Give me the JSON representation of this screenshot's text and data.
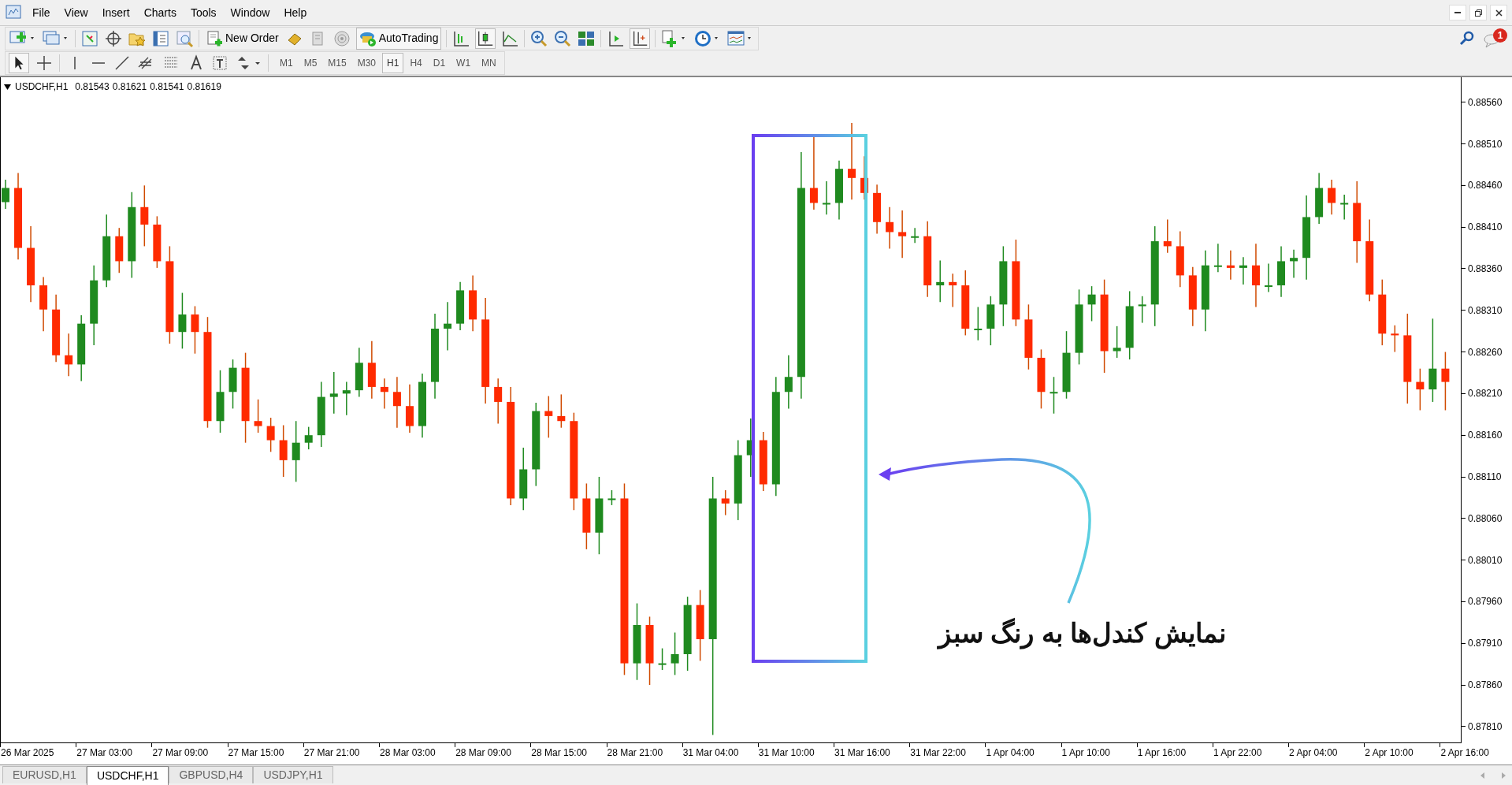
{
  "menu": [
    "File",
    "View",
    "Insert",
    "Charts",
    "Tools",
    "Window",
    "Help"
  ],
  "toolbar": {
    "new_order": "New Order",
    "auto_trading": "AutoTrading"
  },
  "timeframes": [
    {
      "label": "M1",
      "selected": false
    },
    {
      "label": "M5",
      "selected": false
    },
    {
      "label": "M15",
      "selected": false
    },
    {
      "label": "M30",
      "selected": false
    },
    {
      "label": "H1",
      "selected": true
    },
    {
      "label": "H4",
      "selected": false
    },
    {
      "label": "D1",
      "selected": false
    },
    {
      "label": "W1",
      "selected": false
    },
    {
      "label": "MN",
      "selected": false
    }
  ],
  "notification_count": "1",
  "chart": {
    "symbol": "USDCHF,H1",
    "ohlc": [
      "0.81543",
      "0.81621",
      "0.81541",
      "0.81619"
    ],
    "annotation": "نمایش کندل‌ها به رنگ سبز",
    "chart_data": {
      "type": "candlestick",
      "categories": [
        null,
        null,
        "26 Mar 2025",
        null,
        null,
        null,
        null,
        null,
        "27 Mar 03:00",
        null,
        null,
        null,
        null,
        null,
        "27 Mar 09:00",
        null,
        null,
        null,
        null,
        null,
        "27 Mar 15:00",
        null,
        null,
        null,
        null,
        null,
        "27 Mar 21:00",
        null,
        null,
        null,
        null,
        null,
        "28 Mar 03:00",
        null,
        null,
        null,
        null,
        null,
        "28 Mar 09:00",
        null,
        null,
        null,
        null,
        null,
        "28 Mar 15:00",
        null,
        null,
        null,
        null,
        null,
        "28 Mar 21:00",
        null,
        null,
        null,
        null,
        null,
        "31 Mar 04:00",
        null,
        null,
        null,
        null,
        null,
        "31 Mar 10:00",
        null,
        null,
        null,
        null,
        null,
        "31 Mar 16:00",
        null,
        null,
        null,
        null,
        null,
        "31 Mar 22:00",
        null,
        null,
        null,
        null,
        null,
        "1 Apr 04:00",
        null,
        null,
        null,
        null,
        null,
        "1 Apr 10:00",
        null,
        null,
        null,
        null,
        null,
        "1 Apr 16:00",
        null,
        null,
        null,
        null,
        null,
        "1 Apr 22:00",
        null,
        null,
        null,
        null,
        null,
        "2 Apr 04:00",
        null,
        null,
        null,
        null,
        null,
        "2 Apr 10:00",
        null,
        null,
        null,
        null,
        null,
        "2 Apr 16:00"
      ],
      "ylim": [
        0.8779,
        0.8859
      ],
      "ohlc": [
        [
          0.8844,
          0.88467,
          0.88432,
          0.88457
        ],
        [
          0.88457,
          0.88475,
          0.88371,
          0.88385
        ],
        [
          0.88385,
          0.88411,
          0.8832,
          0.8834
        ],
        [
          0.8834,
          0.8835,
          0.88285,
          0.88311
        ],
        [
          0.88311,
          0.88329,
          0.88248,
          0.88256
        ],
        [
          0.88256,
          0.88282,
          0.88231,
          0.88245
        ],
        [
          0.88245,
          0.88304,
          0.88225,
          0.88294
        ],
        [
          0.88294,
          0.88364,
          0.88268,
          0.88346
        ],
        [
          0.88346,
          0.88425,
          0.88338,
          0.88399
        ],
        [
          0.88399,
          0.88409,
          0.88355,
          0.88369
        ],
        [
          0.88369,
          0.88452,
          0.88349,
          0.88434
        ],
        [
          0.88434,
          0.8846,
          0.88387,
          0.88413
        ],
        [
          0.88413,
          0.88423,
          0.88361,
          0.88369
        ],
        [
          0.88369,
          0.88387,
          0.8827,
          0.88284
        ],
        [
          0.88284,
          0.88331,
          0.88264,
          0.88305
        ],
        [
          0.88305,
          0.88315,
          0.88258,
          0.88284
        ],
        [
          0.88284,
          0.88302,
          0.88169,
          0.88177
        ],
        [
          0.88177,
          0.88238,
          0.88163,
          0.88212
        ],
        [
          0.88212,
          0.88251,
          0.88192,
          0.88241
        ],
        [
          0.88241,
          0.88259,
          0.88151,
          0.88177
        ],
        [
          0.88177,
          0.88203,
          0.88163,
          0.88171
        ],
        [
          0.88171,
          0.88181,
          0.8814,
          0.88154
        ],
        [
          0.88154,
          0.88172,
          0.8811,
          0.8813
        ],
        [
          0.8813,
          0.88177,
          0.88104,
          0.88151
        ],
        [
          0.88151,
          0.8817,
          0.88143,
          0.8816
        ],
        [
          0.8816,
          0.88224,
          0.88146,
          0.88206
        ],
        [
          0.88206,
          0.88236,
          0.88186,
          0.8821
        ],
        [
          0.8821,
          0.88224,
          0.88184,
          0.88214
        ],
        [
          0.88214,
          0.88265,
          0.88206,
          0.88247
        ],
        [
          0.88247,
          0.88273,
          0.88204,
          0.88218
        ],
        [
          0.88218,
          0.88228,
          0.88192,
          0.88212
        ],
        [
          0.88212,
          0.8823,
          0.88169,
          0.88195
        ],
        [
          0.88195,
          0.88221,
          0.88163,
          0.88171
        ],
        [
          0.88171,
          0.88234,
          0.88157,
          0.88224
        ],
        [
          0.88224,
          0.88306,
          0.88204,
          0.88288
        ],
        [
          0.88288,
          0.8832,
          0.88262,
          0.88294
        ],
        [
          0.88294,
          0.88344,
          0.88286,
          0.88334
        ],
        [
          0.88334,
          0.88352,
          0.88285,
          0.88299
        ],
        [
          0.88299,
          0.88325,
          0.88198,
          0.88218
        ],
        [
          0.88218,
          0.88228,
          0.88174,
          0.882
        ],
        [
          0.882,
          0.88218,
          0.88076,
          0.88084
        ],
        [
          0.88084,
          0.88145,
          0.8807,
          0.88119
        ],
        [
          0.88119,
          0.88199,
          0.88099,
          0.88189
        ],
        [
          0.88189,
          0.88207,
          0.88157,
          0.88183
        ],
        [
          0.88183,
          0.88209,
          0.88169,
          0.88177
        ],
        [
          0.88177,
          0.88187,
          0.8807,
          0.88084
        ],
        [
          0.88084,
          0.88102,
          0.88023,
          0.88043
        ],
        [
          0.88043,
          0.8811,
          0.88017,
          0.88084
        ],
        [
          0.88084,
          0.88094,
          0.88076,
          0.88084
        ],
        [
          0.88084,
          0.88102,
          0.87872,
          0.87886
        ],
        [
          0.87886,
          0.87958,
          0.87866,
          0.87932
        ],
        [
          0.87932,
          0.87942,
          0.8786,
          0.87886
        ],
        [
          0.87886,
          0.87904,
          0.87878,
          0.87886
        ],
        [
          0.87886,
          0.87923,
          0.87872,
          0.87897
        ],
        [
          0.87897,
          0.87966,
          0.87877,
          0.87956
        ],
        [
          0.87956,
          0.87974,
          0.87889,
          0.87915
        ],
        [
          0.87915,
          0.8811,
          0.878,
          0.88084
        ],
        [
          0.88084,
          0.88094,
          0.88064,
          0.88078
        ],
        [
          0.88078,
          0.88154,
          0.88058,
          0.88136
        ],
        [
          0.88136,
          0.8818,
          0.8811,
          0.88154
        ],
        [
          0.88154,
          0.88164,
          0.88093,
          0.88101
        ],
        [
          0.88101,
          0.8823,
          0.88087,
          0.88212
        ],
        [
          0.88212,
          0.88256,
          0.88192,
          0.8823
        ],
        [
          0.8823,
          0.885,
          0.88204,
          0.88457
        ],
        [
          0.88457,
          0.8852,
          0.88431,
          0.88439
        ],
        [
          0.88439,
          0.88465,
          0.88425,
          0.88439
        ],
        [
          0.88439,
          0.8849,
          0.88419,
          0.8848
        ],
        [
          0.8848,
          0.88535,
          0.88443,
          0.88469
        ],
        [
          0.88469,
          0.88495,
          0.88443,
          0.88451
        ],
        [
          0.88451,
          0.88461,
          0.88402,
          0.88416
        ],
        [
          0.88416,
          0.88434,
          0.88384,
          0.88404
        ],
        [
          0.88404,
          0.8843,
          0.88373,
          0.88399
        ],
        [
          0.88399,
          0.88409,
          0.88391,
          0.88399
        ],
        [
          0.88399,
          0.88417,
          0.88326,
          0.8834
        ],
        [
          0.8834,
          0.8837,
          0.8832,
          0.88344
        ],
        [
          0.88344,
          0.88354,
          0.88314,
          0.8834
        ],
        [
          0.8834,
          0.88358,
          0.8828,
          0.88288
        ],
        [
          0.88288,
          0.88314,
          0.88274,
          0.88288
        ],
        [
          0.88288,
          0.88327,
          0.88268,
          0.88317
        ],
        [
          0.88317,
          0.88387,
          0.88291,
          0.88369
        ],
        [
          0.88369,
          0.88395,
          0.88291,
          0.88299
        ],
        [
          0.88299,
          0.88317,
          0.88239,
          0.88253
        ],
        [
          0.88253,
          0.88263,
          0.88192,
          0.88212
        ],
        [
          0.88212,
          0.8823,
          0.88186,
          0.88212
        ],
        [
          0.88212,
          0.88285,
          0.88204,
          0.88259
        ],
        [
          0.88259,
          0.88335,
          0.88245,
          0.88317
        ],
        [
          0.88317,
          0.88339,
          0.88297,
          0.88329
        ],
        [
          0.88329,
          0.88347,
          0.88235,
          0.88261
        ],
        [
          0.88261,
          0.88291,
          0.88253,
          0.88265
        ],
        [
          0.88265,
          0.88333,
          0.88251,
          0.88315
        ],
        [
          0.88315,
          0.88327,
          0.88295,
          0.88317
        ],
        [
          0.88317,
          0.88411,
          0.88291,
          0.88393
        ],
        [
          0.88393,
          0.88419,
          0.88379,
          0.88387
        ],
        [
          0.88387,
          0.88405,
          0.88338,
          0.88352
        ],
        [
          0.88352,
          0.88362,
          0.88291,
          0.88311
        ],
        [
          0.88311,
          0.88382,
          0.88285,
          0.88364
        ],
        [
          0.88364,
          0.8839,
          0.88356,
          0.88364
        ],
        [
          0.88364,
          0.88382,
          0.88347,
          0.88361
        ],
        [
          0.88361,
          0.88374,
          0.88341,
          0.88364
        ],
        [
          0.88364,
          0.8839,
          0.88314,
          0.8834
        ],
        [
          0.8834,
          0.88366,
          0.88332,
          0.8834
        ],
        [
          0.8834,
          0.88387,
          0.88326,
          0.88369
        ],
        [
          0.88369,
          0.88383,
          0.88349,
          0.88373
        ],
        [
          0.88373,
          0.88448,
          0.88347,
          0.88422
        ],
        [
          0.88422,
          0.88475,
          0.88414,
          0.88457
        ],
        [
          0.88457,
          0.88467,
          0.88425,
          0.88439
        ],
        [
          0.88439,
          0.88449,
          0.88419,
          0.88439
        ],
        [
          0.88439,
          0.88465,
          0.88367,
          0.88393
        ],
        [
          0.88393,
          0.88419,
          0.88321,
          0.88329
        ],
        [
          0.88329,
          0.88347,
          0.88268,
          0.88282
        ],
        [
          0.88282,
          0.88292,
          0.8826,
          0.8828
        ],
        [
          0.8828,
          0.88306,
          0.88198,
          0.88224
        ],
        [
          0.88224,
          0.8824,
          0.8819,
          0.88215
        ],
        [
          0.88215,
          0.883,
          0.882,
          0.8824
        ],
        [
          0.8824,
          0.8826,
          0.8819,
          0.88224
        ],
        null,
        null
      ],
      "yticks": [
        {
          "value": 0.8856,
          "label": "0.88560"
        },
        {
          "value": 0.8851,
          "label": "0.88510"
        },
        {
          "value": 0.8846,
          "label": "0.88460"
        },
        {
          "value": 0.8841,
          "label": "0.88410"
        },
        {
          "value": 0.8836,
          "label": "0.88360"
        },
        {
          "value": 0.8831,
          "label": "0.88310"
        },
        {
          "value": 0.8826,
          "label": "0.88260"
        },
        {
          "value": 0.8821,
          "label": "0.88210"
        },
        {
          "value": 0.8816,
          "label": "0.88160"
        },
        {
          "value": 0.8811,
          "label": "0.88110"
        },
        {
          "value": 0.8806,
          "label": "0.88060"
        },
        {
          "value": 0.8801,
          "label": "0.88010"
        },
        {
          "value": 0.8796,
          "label": "0.87960"
        },
        {
          "value": 0.8791,
          "label": "0.87910"
        },
        {
          "value": 0.8786,
          "label": "0.87860"
        },
        {
          "value": 0.8781,
          "label": "0.87810"
        }
      ]
    }
  },
  "tabs": [
    {
      "label": "EURUSD,H1",
      "selected": false
    },
    {
      "label": "USDCHF,H1",
      "selected": true
    },
    {
      "label": "GBPUSD,H4",
      "selected": false
    },
    {
      "label": "USDJPY,H1",
      "selected": false
    }
  ]
}
